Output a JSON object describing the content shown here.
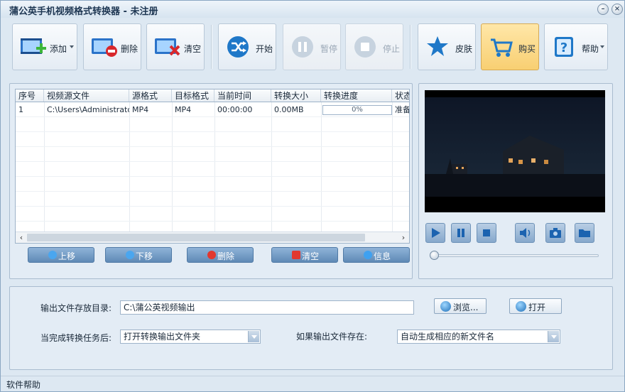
{
  "window": {
    "title": "蒲公英手机视频格式转换器 - 未注册"
  },
  "toolbar": {
    "add": "添加",
    "delete": "删除",
    "clear": "清空",
    "start": "开始",
    "pause": "暂停",
    "stop": "停止",
    "skin": "皮肤",
    "buy": "购买",
    "help": "帮助"
  },
  "table": {
    "columns": [
      "序号",
      "视频源文件",
      "源格式",
      "目标格式",
      "当前时间",
      "转换大小",
      "转换进度",
      "状态"
    ],
    "rows": [
      {
        "index": "1",
        "source": "C:\\Users\\Administrator...",
        "src_format": "MP4",
        "dst_format": "MP4",
        "time": "00:00:00",
        "size": "0.00MB",
        "progress": "0%",
        "status": "准备"
      }
    ]
  },
  "list_buttons": {
    "up": "上移",
    "down": "下移",
    "delete": "删除",
    "clear": "清空",
    "info": "信息"
  },
  "output": {
    "dir_label": "输出文件存放目录:",
    "dir_value": "C:\\蒲公英视频输出",
    "browse": "浏览...",
    "open": "打开",
    "after_label": "当完成转换任务后:",
    "after_value": "打开转换输出文件夹",
    "exists_label": "如果输出文件存在:",
    "exists_value": "自动生成相应的新文件名"
  },
  "status": {
    "text": "软件帮助"
  },
  "colors": {
    "accent": "#5f8ab6",
    "buy": "#f8cf72",
    "window": "#dde8f2"
  },
  "player": {
    "progress": 0
  }
}
